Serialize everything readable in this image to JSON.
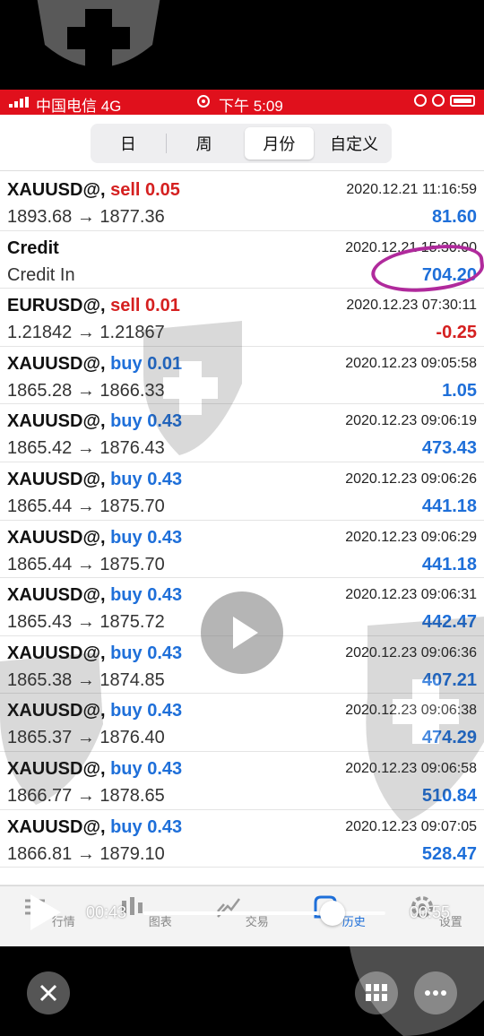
{
  "status_bar": {
    "carrier": "中国电信  4G",
    "time": "下午 5:09"
  },
  "segments": [
    {
      "label": "日",
      "active": false
    },
    {
      "label": "周",
      "active": false
    },
    {
      "label": "月份",
      "active": true
    },
    {
      "label": "自定义",
      "active": false
    }
  ],
  "rows": [
    {
      "symbol": "XAUUSD@,",
      "side": "sell 0.05",
      "side_type": "sell",
      "prices": "1893.68 → 1877.36",
      "time": "2020.12.21 11:16:59",
      "profit": "81.60",
      "profit_type": "pos"
    },
    {
      "symbol": "Credit",
      "side": "",
      "side_type": "",
      "prices": "Credit In",
      "time": "2020.12.21 15:30:00",
      "profit": "704.20",
      "profit_type": "pos"
    },
    {
      "symbol": "EURUSD@,",
      "side": "sell 0.01",
      "side_type": "sell",
      "prices": "1.21842 → 1.21867",
      "time": "2020.12.23 07:30:11",
      "profit": "-0.25",
      "profit_type": "neg"
    },
    {
      "symbol": "XAUUSD@,",
      "side": "buy 0.01",
      "side_type": "buy",
      "prices": "1865.28 → 1866.33",
      "time": "2020.12.23 09:05:58",
      "profit": "1.05",
      "profit_type": "pos"
    },
    {
      "symbol": "XAUUSD@,",
      "side": "buy 0.43",
      "side_type": "buy",
      "prices": "1865.42 → 1876.43",
      "time": "2020.12.23 09:06:19",
      "profit": "473.43",
      "profit_type": "pos"
    },
    {
      "symbol": "XAUUSD@,",
      "side": "buy 0.43",
      "side_type": "buy",
      "prices": "1865.44 → 1875.70",
      "time": "2020.12.23 09:06:26",
      "profit": "441.18",
      "profit_type": "pos"
    },
    {
      "symbol": "XAUUSD@,",
      "side": "buy 0.43",
      "side_type": "buy",
      "prices": "1865.44 → 1875.70",
      "time": "2020.12.23 09:06:29",
      "profit": "441.18",
      "profit_type": "pos"
    },
    {
      "symbol": "XAUUSD@,",
      "side": "buy 0.43",
      "side_type": "buy",
      "prices": "1865.43 → 1875.72",
      "time": "2020.12.23 09:06:31",
      "profit": "442.47",
      "profit_type": "pos"
    },
    {
      "symbol": "XAUUSD@,",
      "side": "buy 0.43",
      "side_type": "buy",
      "prices": "1865.38 → 1874.85",
      "time": "2020.12.23 09:06:36",
      "profit": "407.21",
      "profit_type": "pos"
    },
    {
      "symbol": "XAUUSD@,",
      "side": "buy 0.43",
      "side_type": "buy",
      "prices": "1865.37 → 1876.40",
      "time": "2020.12.23 09:06:38",
      "profit": "474.29",
      "profit_type": "pos"
    },
    {
      "symbol": "XAUUSD@,",
      "side": "buy 0.43",
      "side_type": "buy",
      "prices": "1866.77 → 1878.65",
      "time": "2020.12.23 09:06:58",
      "profit": "510.84",
      "profit_type": "pos"
    },
    {
      "symbol": "XAUUSD@,",
      "side": "buy 0.43",
      "side_type": "buy",
      "prices": "1866.81 → 1879.10",
      "time": "2020.12.23 09:07:05",
      "profit": "528.47",
      "profit_type": "pos"
    }
  ],
  "nav": [
    {
      "label": "行情",
      "icon": "quotes-icon",
      "active": false
    },
    {
      "label": "图表",
      "icon": "chart-icon",
      "active": false
    },
    {
      "label": "交易",
      "icon": "trade-icon",
      "active": false
    },
    {
      "label": "历史",
      "icon": "history-icon",
      "active": true
    },
    {
      "label": "设置",
      "icon": "settings-icon",
      "active": false
    }
  ],
  "video": {
    "elapsed": "00:43",
    "total": "00:55",
    "progress": 0.78
  },
  "colors": {
    "status_bar": "#e0101c",
    "buy": "#1e6fd9",
    "sell": "#d52020",
    "highlight_circle": "#b02a9c"
  }
}
